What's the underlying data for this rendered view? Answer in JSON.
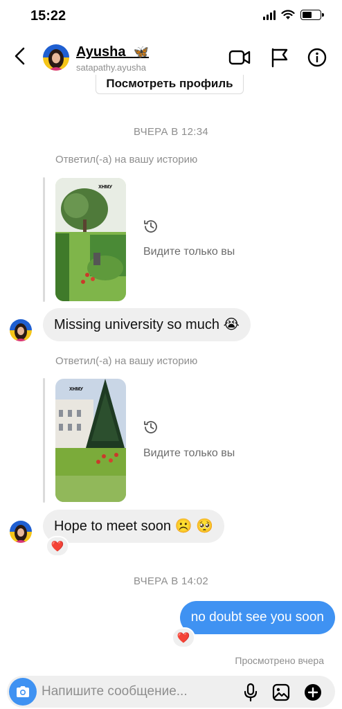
{
  "status_bar": {
    "time": "15:22",
    "battery_level": 0.55
  },
  "header": {
    "name": "Ayusha_",
    "name_emoji": "🦋",
    "username": "satapathy.ayusha",
    "icons": [
      "back-arrow-icon",
      "video-camera-icon",
      "flag-icon",
      "info-icon"
    ]
  },
  "chat": {
    "profile_button": "Посмотреть профиль",
    "timestamp_1": "ВЧЕРА В 12:34",
    "story_reply_1": {
      "label": "Ответил(-а) на вашу историю",
      "only_you": "Видите только вы",
      "thumb_text": "ХНМУ"
    },
    "message_1": "Missing university so much 😭",
    "story_reply_2": {
      "label": "Ответил(-а) на вашу историю",
      "only_you": "Видите только вы",
      "thumb_text": "ХНМУ"
    },
    "message_2": "Hope to meet soon ☹️ 🥺",
    "message_2_reaction": "❤️",
    "timestamp_2": "ВЧЕРА В 14:02",
    "message_3": "no doubt see you soon",
    "message_3_reaction": "❤️",
    "seen": "Просмотрено вчера"
  },
  "composer": {
    "placeholder": "Напишите сообщение...",
    "icons": [
      "camera-icon",
      "microphone-icon",
      "gallery-icon",
      "add-icon"
    ]
  },
  "colors": {
    "accent": "#3f92f2",
    "bubble_in": "#efefef",
    "muted": "#8e8e8e"
  }
}
